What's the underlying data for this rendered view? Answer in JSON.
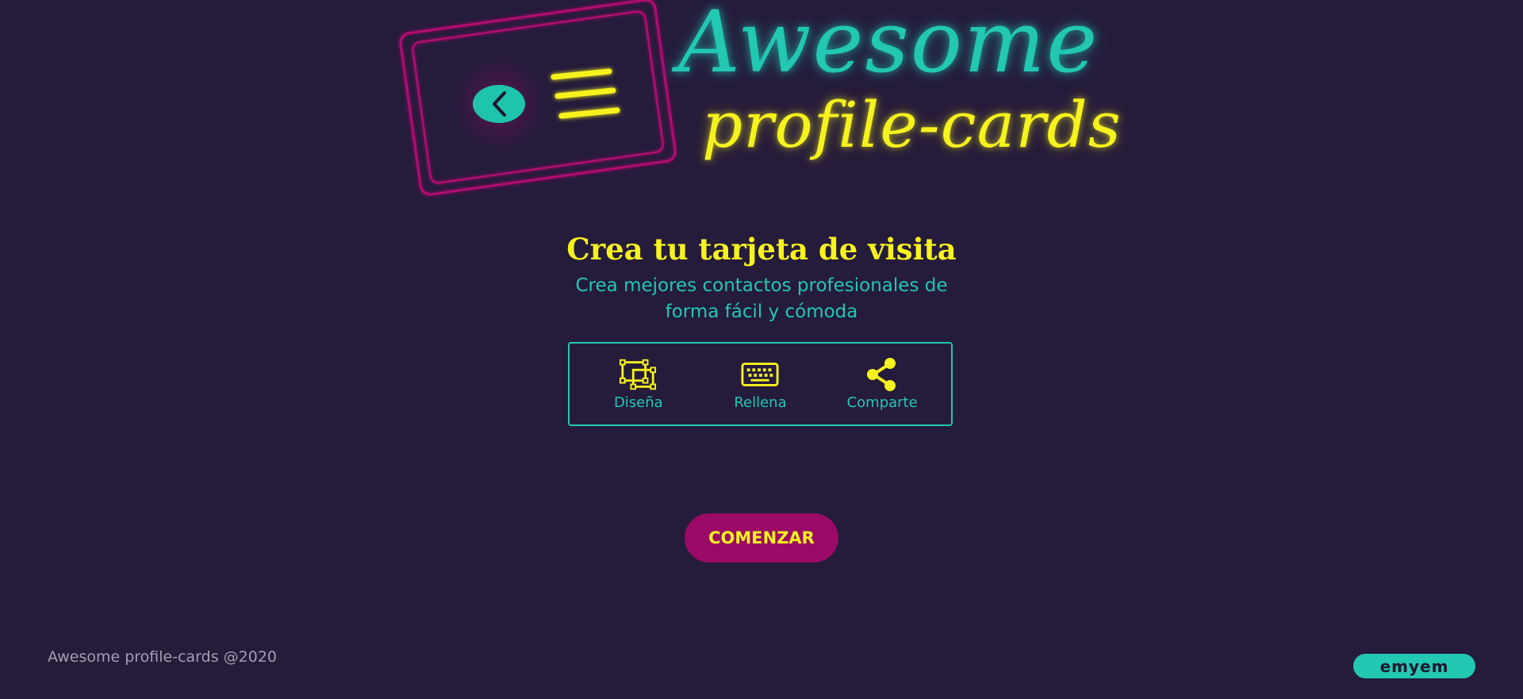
{
  "logo": {
    "word_1": "Awesome",
    "word_2": "profile-cards",
    "icon": "profile-card-neon-icon"
  },
  "intro": {
    "title": "Crea tu tarjeta de visita",
    "subtitle": "Crea mejores contactos profesionales de forma fácil y cómoda"
  },
  "steps": [
    {
      "icon": "design-frame-icon",
      "label": "Diseña"
    },
    {
      "icon": "keyboard-icon",
      "label": "Rellena"
    },
    {
      "icon": "share-icon",
      "label": "Comparte"
    }
  ],
  "cta": {
    "label": "COMENZAR"
  },
  "footer": {
    "copyright": "Awesome profile-cards @2020",
    "badge": "emyem"
  },
  "colors": {
    "background": "#251b3b",
    "teal": "#22c8b1",
    "yellow": "#f6f21e",
    "magenta": "#9a0a66"
  }
}
